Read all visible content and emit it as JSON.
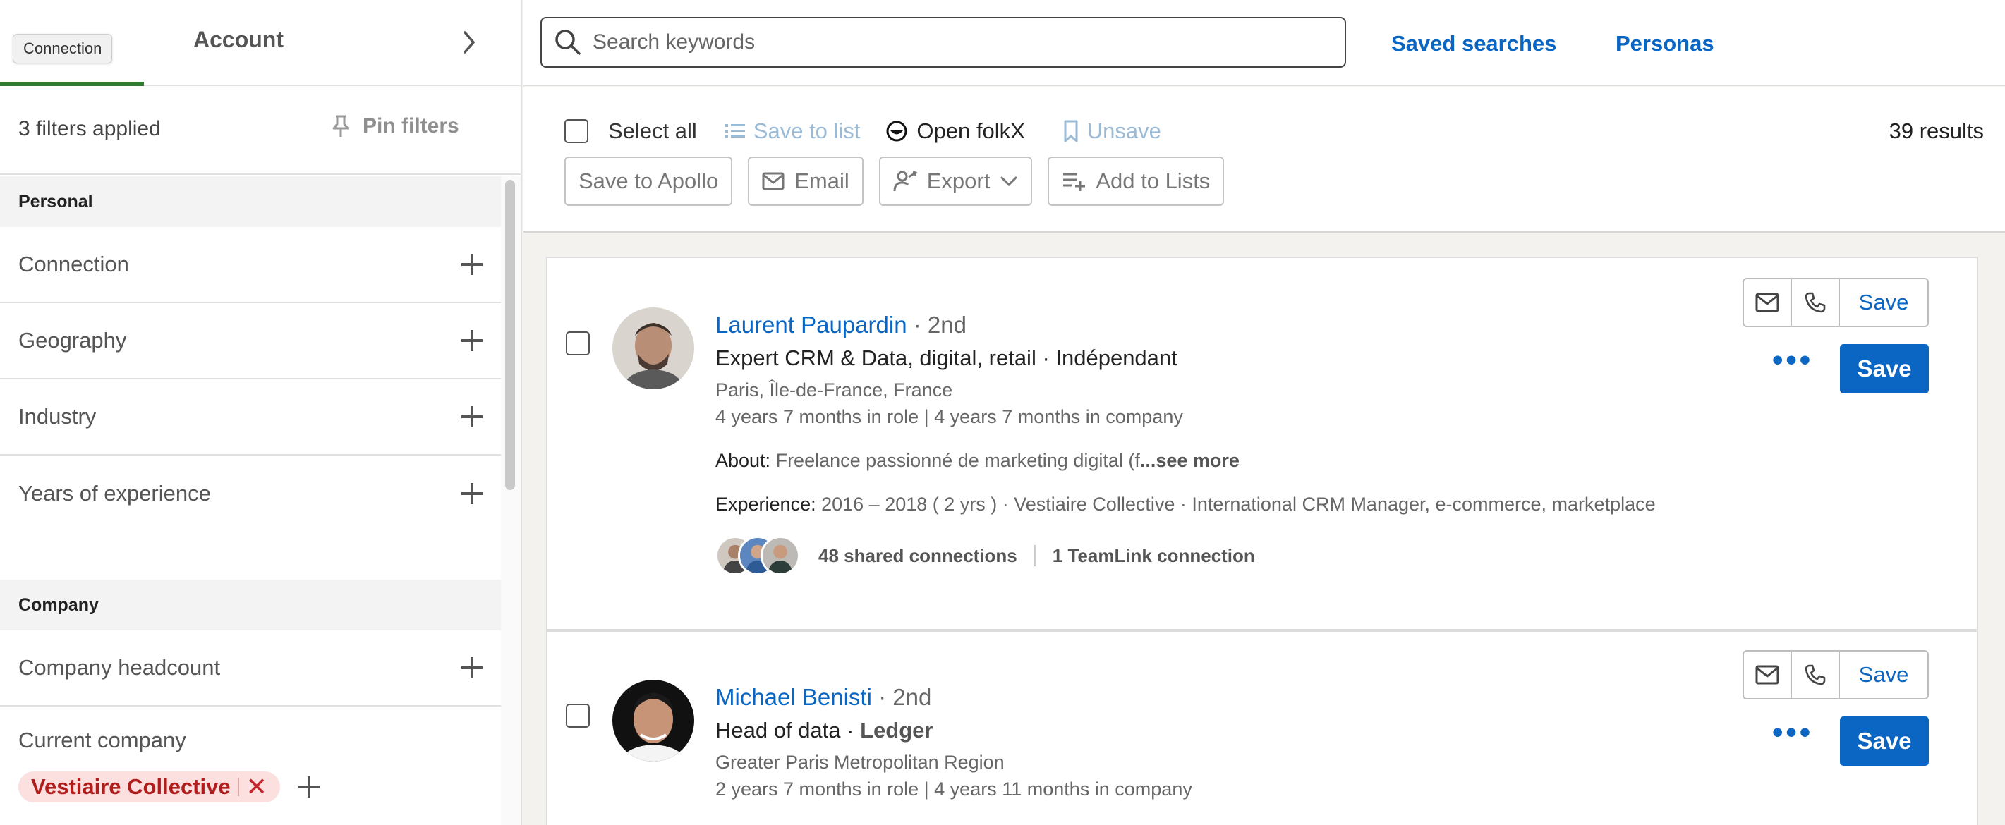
{
  "tabs": {
    "tooltip": "Connection",
    "account": "Account"
  },
  "filters": {
    "applied": "3 filters applied",
    "pin": "Pin filters",
    "sections": [
      {
        "title": "Personal",
        "items": [
          "Connection",
          "Geography",
          "Industry",
          "Years of experience"
        ]
      },
      {
        "title": "Company",
        "items": [
          "Company headcount"
        ]
      }
    ],
    "current_company": {
      "label": "Current company",
      "chip": "Vestiaire Collective"
    }
  },
  "header": {
    "search_placeholder": "Search keywords",
    "saved_searches": "Saved searches",
    "personas": "Personas"
  },
  "toolbar": {
    "select_all": "Select all",
    "save_to_list": "Save to list",
    "open_folkx": "Open folkX",
    "unsave": "Unsave",
    "results": "39 results",
    "save_to_apollo": "Save to Apollo",
    "email": "Email",
    "export": "Export",
    "add_to_lists": "Add to Lists"
  },
  "leads": [
    {
      "name": "Laurent Paupardin",
      "degree": "· 2nd",
      "title": "Expert CRM & Data, digital, retail · Indépendant",
      "location": "Paris, Île-de-France, France",
      "tenure": "4 years 7 months in role | 4 years 7 months in company",
      "about_label": "About:",
      "about": "Freelance passionné de marketing digital (f",
      "see_more": "...see more",
      "experience_label": "Experience:",
      "experience": "2016 – 2018  ( 2 yrs ) · Vestiaire Collective · International CRM Manager, e-commerce, marketplace",
      "shared": "48 shared connections",
      "teamlink": "1 TeamLink connection",
      "save": "Save"
    },
    {
      "name": "Michael Benisti",
      "degree": "· 2nd",
      "title": "Head of data · ",
      "company": "Ledger",
      "location": "Greater Paris Metropolitan Region",
      "tenure": "2 years 7 months in role | 4 years 11 months in company",
      "save": "Save"
    }
  ],
  "colors": {
    "brand_blue": "#0a66c2",
    "chip_red": "#b01d1d",
    "tab_green": "#2f7b2f"
  }
}
